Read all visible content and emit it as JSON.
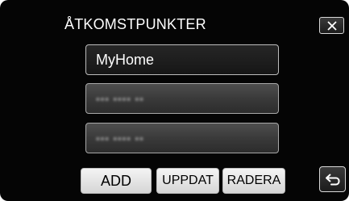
{
  "header": {
    "title": "ÅTKOMSTPUNKTER",
    "close_icon": "close-icon"
  },
  "access_points": [
    {
      "label": "MyHome",
      "selected": true,
      "obscured": false
    },
    {
      "label": "▪▪▪ ▪▪▪▪ ▪▪",
      "selected": false,
      "obscured": true
    },
    {
      "label": "▪▪▪ ▪▪▪▪ ▪▪",
      "selected": false,
      "obscured": true
    }
  ],
  "footer": {
    "add_label": "ADD",
    "update_label": "UPPDAT",
    "delete_label": "RADERA",
    "back_icon": "return-arrow-icon"
  },
  "colors": {
    "background": "#050505",
    "button_light": "#e6e6e6",
    "item_dark": "#3a3a3a",
    "text": "#ffffff"
  }
}
